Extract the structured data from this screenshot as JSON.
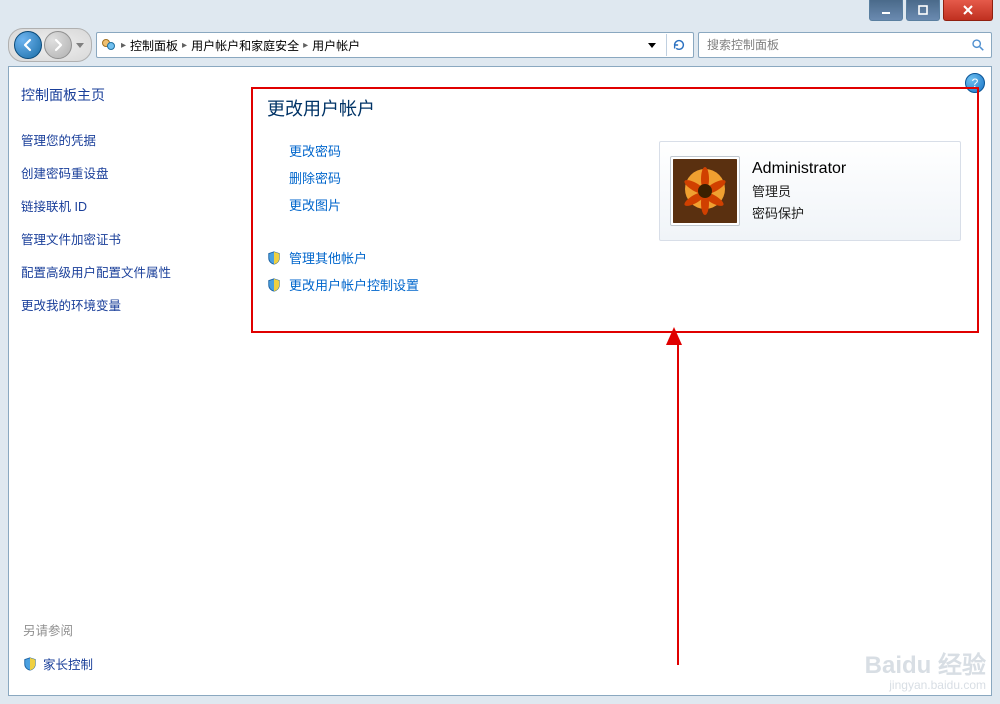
{
  "breadcrumb": {
    "items": [
      "控制面板",
      "用户帐户和家庭安全",
      "用户帐户"
    ]
  },
  "search": {
    "placeholder": "搜索控制面板"
  },
  "sidebar": {
    "home": "控制面板主页",
    "tasks": [
      "管理您的凭据",
      "创建密码重设盘",
      "链接联机 ID",
      "管理文件加密证书",
      "配置高级用户配置文件属性",
      "更改我的环境变量"
    ],
    "see_also_label": "另请参阅",
    "parental": "家长控制"
  },
  "main": {
    "heading": "更改用户帐户",
    "links": [
      "更改密码",
      "删除密码",
      "更改图片"
    ],
    "shield_links": [
      "管理其他帐户",
      "更改用户帐户控制设置"
    ]
  },
  "user": {
    "name": "Administrator",
    "role": "管理员",
    "protection": "密码保护"
  },
  "watermark": {
    "l1": "Baidu 经验",
    "l2": "jingyan.baidu.com"
  },
  "help": "?"
}
